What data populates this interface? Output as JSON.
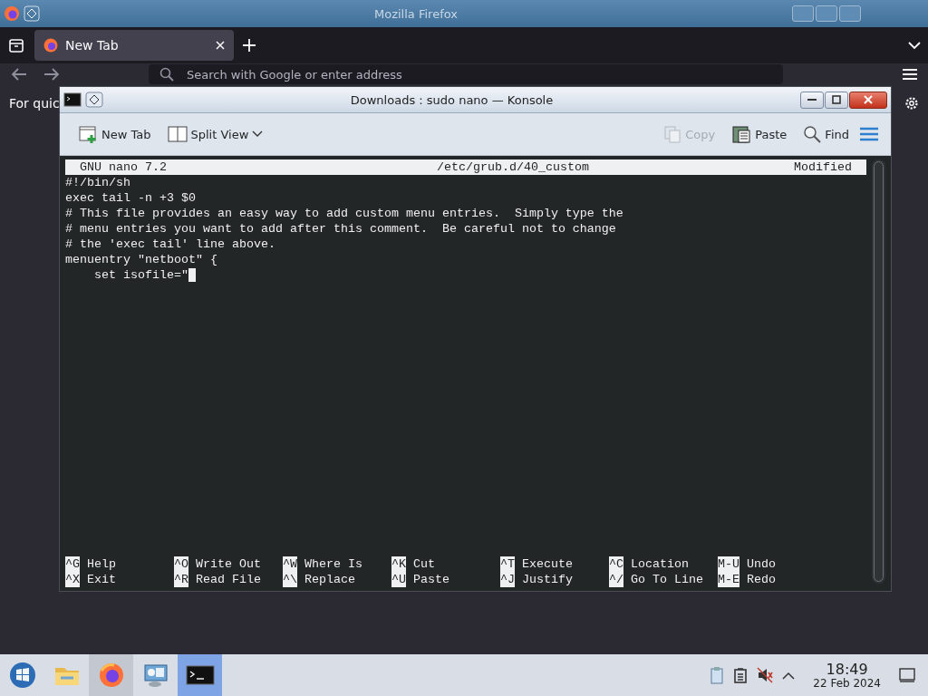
{
  "firefox": {
    "title": "Mozilla Firefox",
    "tabs": [
      {
        "label": "New Tab",
        "selected": true
      }
    ],
    "search": {
      "placeholder": "Search with Google or enter address"
    },
    "bookmarks_text": "For quic"
  },
  "konsole": {
    "title": "Downloads : sudo nano — Konsole",
    "toolbar": [
      {
        "kind": "new-tab",
        "label": "New Tab",
        "disabled": false
      },
      {
        "kind": "split",
        "label": "Split View",
        "disabled": false
      },
      {
        "kind": "copy",
        "label": "Copy",
        "disabled": true
      },
      {
        "kind": "paste",
        "label": "Paste",
        "disabled": false
      },
      {
        "kind": "find",
        "label": "Find",
        "disabled": false
      }
    ],
    "nano": {
      "version": "GNU nano 7.2",
      "file": "/etc/grub.d/40_custom",
      "status": "Modified",
      "lines": [
        {
          "text": "#!/bin/sh",
          "cursor": false
        },
        {
          "text": "exec tail -n +3 $0",
          "cursor": false
        },
        {
          "text": "# This file provides an easy way to add custom menu entries.  Simply type the",
          "cursor": false
        },
        {
          "text": "# menu entries you want to add after this comment.  Be careful not to change",
          "cursor": false
        },
        {
          "text": "# the 'exec tail' line above.",
          "cursor": false
        },
        {
          "text": "menuentry \"netboot\" {",
          "cursor": false
        },
        {
          "text": "    set isofile=\"",
          "cursor": true
        }
      ],
      "shortcuts": [
        [
          {
            "key": "^G",
            "label": "Help"
          },
          {
            "key": "^O",
            "label": "Write Out"
          },
          {
            "key": "^W",
            "label": "Where Is"
          },
          {
            "key": "^K",
            "label": "Cut"
          },
          {
            "key": "^T",
            "label": "Execute"
          },
          {
            "key": "^C",
            "label": "Location"
          },
          {
            "key": "M-U",
            "label": "Undo"
          }
        ],
        [
          {
            "key": "^X",
            "label": "Exit"
          },
          {
            "key": "^R",
            "label": "Read File"
          },
          {
            "key": "^\\",
            "label": "Replace"
          },
          {
            "key": "^U",
            "label": "Paste"
          },
          {
            "key": "^J",
            "label": "Justify"
          },
          {
            "key": "^/",
            "label": "Go To Line"
          },
          {
            "key": "M-E",
            "label": "Redo"
          }
        ]
      ]
    }
  },
  "taskbar": {
    "apps": [
      {
        "kind": "start",
        "selected": false,
        "highlighted": false
      },
      {
        "kind": "files",
        "selected": false,
        "highlighted": false
      },
      {
        "kind": "browser",
        "selected": false,
        "highlighted": true
      },
      {
        "kind": "network",
        "selected": false,
        "highlighted": false
      },
      {
        "kind": "terminal",
        "selected": true,
        "highlighted": false
      }
    ],
    "clock": {
      "time": "18:49",
      "date": "22 Feb 2024"
    }
  }
}
